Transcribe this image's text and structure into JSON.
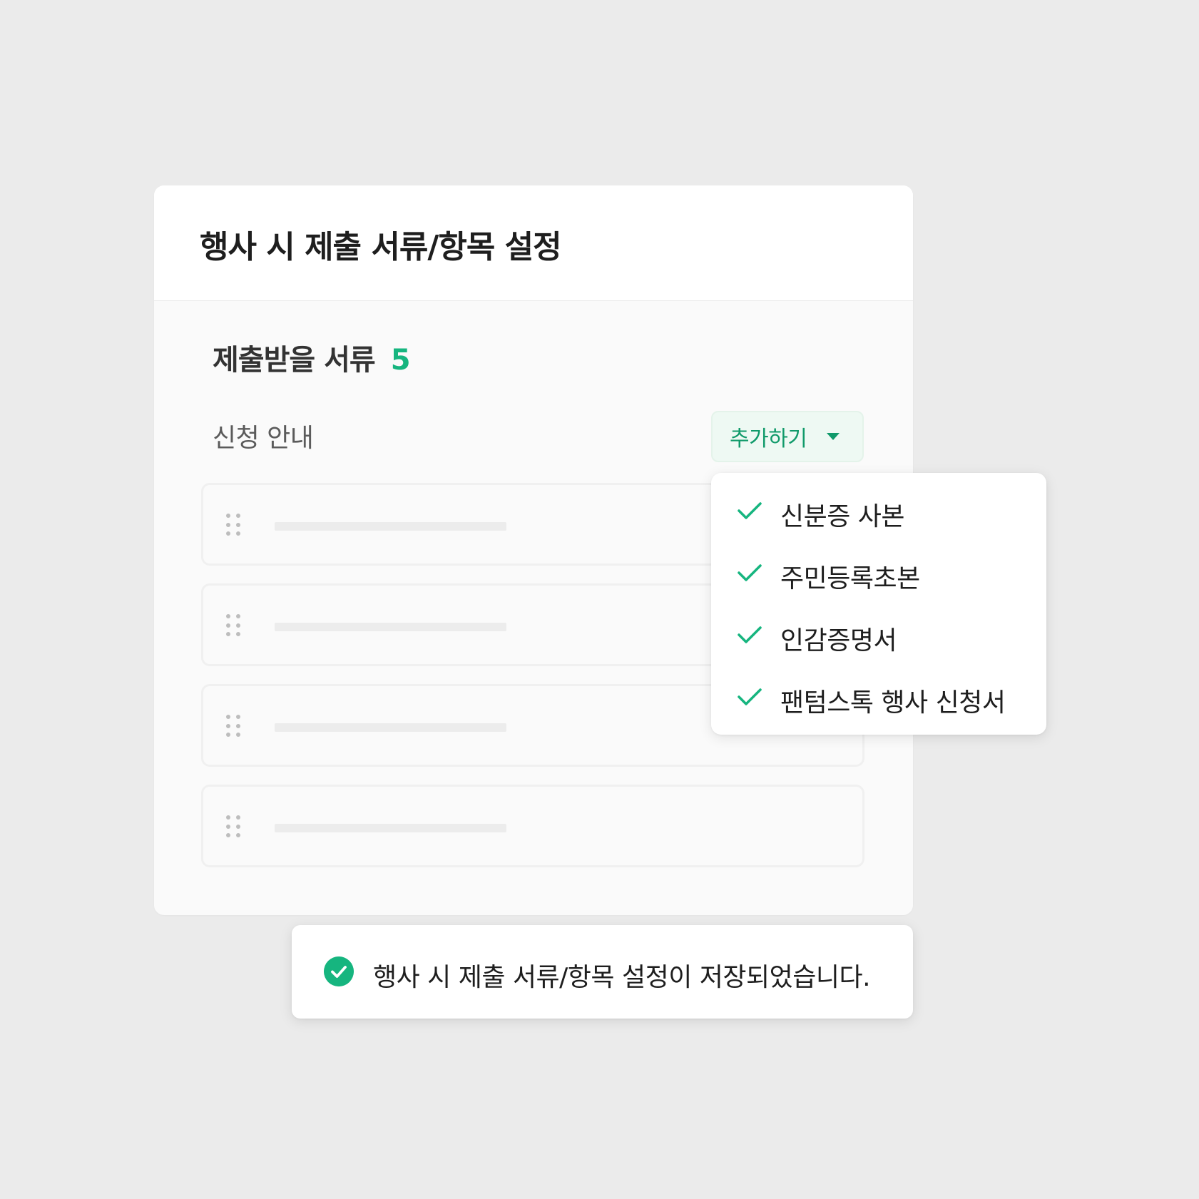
{
  "header": {
    "title": "행사 시 제출 서류/항목 설정"
  },
  "documents_section": {
    "title": "제출받을 서류",
    "count": "5"
  },
  "guide_section": {
    "label": "신청 안내",
    "add_button_label": "추가하기"
  },
  "dropdown": {
    "items": [
      {
        "label": "신분증 사본",
        "checked": true
      },
      {
        "label": "주민등록초본",
        "checked": true
      },
      {
        "label": "인감증명서",
        "checked": true
      },
      {
        "label": "팬텀스톡 행사 신청서",
        "checked": true
      }
    ]
  },
  "toast": {
    "message": "행사 시 제출 서류/항목 설정이 저장되었습니다.",
    "icon": "check-circle-icon"
  },
  "colors": {
    "accent": "#16b57f",
    "accent_dark": "#109a6a",
    "background": "#ebebeb",
    "card": "#fafafa"
  }
}
